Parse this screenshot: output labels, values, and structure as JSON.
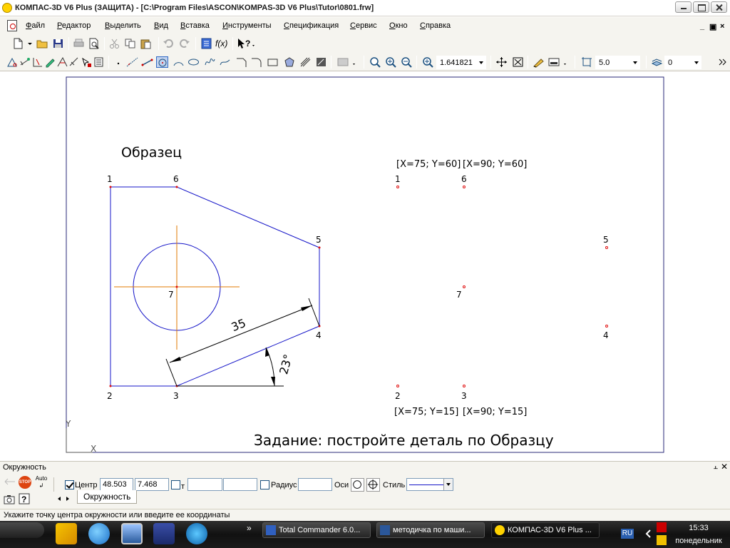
{
  "window": {
    "title": "КОМПАС-3D V6 Plus (ЗАЩИТА) - [C:\\Program Files\\ASCON\\KOMPAS-3D V6 Plus\\Tutor\\0801.frw]"
  },
  "menu": {
    "items": [
      {
        "u": "Ф",
        "rest": "айл"
      },
      {
        "u": "Р",
        "rest": "едактор"
      },
      {
        "u": "В",
        "rest": "ыделить"
      },
      {
        "u": "В",
        "rest": "ид"
      },
      {
        "u": "В",
        "rest": "ставка"
      },
      {
        "u": "И",
        "rest": "нструменты"
      },
      {
        "u": "С",
        "rest": "пецификация"
      },
      {
        "u": "С",
        "rest": "ервис"
      },
      {
        "u": "О",
        "rest": "кно"
      },
      {
        "u": "С",
        "rest": "правка"
      }
    ],
    "mdi_controls": [
      "_",
      "▣",
      "×"
    ]
  },
  "toolbar": {
    "fx_label": "f(x)",
    "help_label": "?",
    "zoom_value": "1.641821",
    "step_value": "5.0",
    "layer_value": "0"
  },
  "drawing": {
    "sample_title": "Образец",
    "task_text": "Задание: постройте деталь по Образцу",
    "dimension_length": "35",
    "dimension_angle": "23°",
    "point_labels": {
      "p1": "1",
      "p2": "2",
      "p3": "3",
      "p4": "4",
      "p5": "5",
      "p6": "6",
      "p7": "7"
    },
    "target_labels": {
      "t1": "1",
      "t2": "2",
      "t3": "3",
      "t4": "4",
      "t5": "5",
      "t6": "6",
      "t7": "7"
    },
    "coords": {
      "top_left": "[X=75; Y=60]",
      "top_right": "[X=90; Y=60]",
      "bottom_left": "[X=75; Y=15]",
      "bottom_right": "[X=90; Y=15]"
    },
    "axis_x": "X",
    "axis_y": "Y",
    "colors": {
      "contour": "#1414c8",
      "axis": "#e07800",
      "points": "#e01010",
      "dimension": "#000000"
    }
  },
  "properties": {
    "panel_title": "Окружность",
    "stop_label": "STOP",
    "auto_label": "Auto",
    "center_label": "Центр",
    "center_x": "48.503",
    "center_y": "7.468",
    "t_label": "т",
    "radius_label": "Радиус",
    "axes_label": "Оси",
    "style_label": "Стиль",
    "tab_label": "Окружность",
    "pin_label": "⫠",
    "close_label": "✕"
  },
  "status": {
    "hint": "Укажите точку центра окружности или введите ее координаты"
  },
  "taskbar": {
    "more_label": "»",
    "tasks": [
      {
        "label": "Total Commander 6.0...",
        "icon_color": "#3060c0"
      },
      {
        "label": "методичка по маши...",
        "icon_color": "#2b579a"
      },
      {
        "label": "КОМПАС-3D V6 Plus ...",
        "icon_color": "#ffd200"
      }
    ],
    "lang": "RU",
    "time": "15:33",
    "day": "понедельник"
  }
}
